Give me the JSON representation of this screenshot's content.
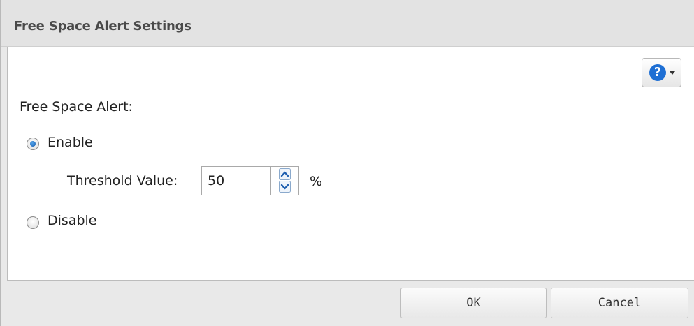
{
  "dialog": {
    "title": "Free Space Alert Settings"
  },
  "form": {
    "free_space_alert_label": "Free Space Alert:",
    "enable_label": "Enable",
    "enable_checked": true,
    "threshold_label": "Threshold Value:",
    "threshold_value": "50",
    "threshold_unit": "%",
    "disable_label": "Disable",
    "disable_checked": false
  },
  "help": {
    "icon": "help-icon",
    "glyph": "?",
    "caret": "chevron-down-icon"
  },
  "footer": {
    "ok_label": "OK",
    "cancel_label": "Cancel"
  },
  "colors": {
    "accent": "#1e6fd4",
    "radio_dot": "#1a5fb0"
  }
}
